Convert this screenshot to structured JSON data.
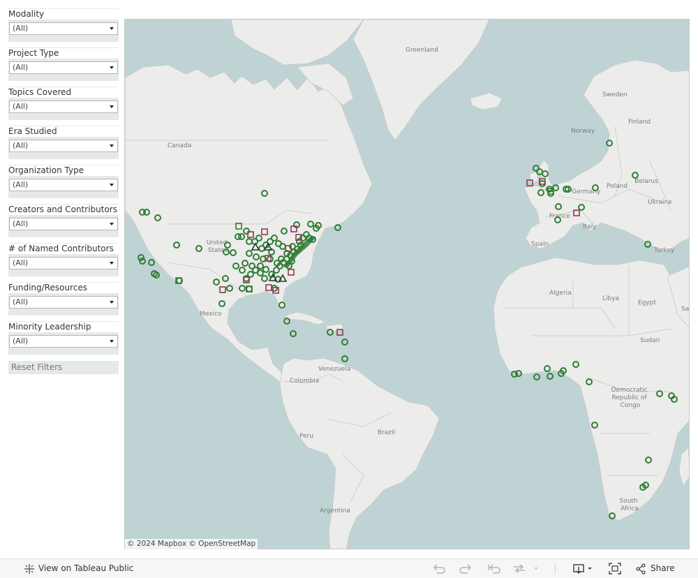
{
  "filters": [
    {
      "label": "Modality",
      "value": "(All)"
    },
    {
      "label": "Project Type",
      "value": "(All)"
    },
    {
      "label": "Topics Covered",
      "value": "(All)"
    },
    {
      "label": "Era Studied",
      "value": "(All)"
    },
    {
      "label": "Organization Type",
      "value": "(All)"
    },
    {
      "label": "Creators and Contributors",
      "value": "(All)"
    },
    {
      "label": "# of Named Contributors",
      "value": "(All)"
    },
    {
      "label": "Funding/Resources",
      "value": "(All)"
    },
    {
      "label": "Minority Leadership",
      "value": "(All)"
    }
  ],
  "reset_label": "Reset Filters",
  "map": {
    "labels": [
      "Greenland",
      "Canada",
      "Sweden",
      "Finland",
      "Norway",
      "Belarus",
      "Poland",
      "Ukraine",
      "Germany",
      "France",
      "Italy",
      "Spain",
      "Turkey",
      "Algeria",
      "Libya",
      "Egypt",
      "Sudan",
      "Mexico",
      "Venezuela",
      "Colombia",
      "Brazil",
      "Peru",
      "Argentina",
      "Democratic Republic of Congo",
      "South Africa",
      "United States",
      "Sau"
    ],
    "attribution": "© 2024 Mapbox © OpenStreetMap",
    "colors": {
      "water": "#bfd3d4",
      "land": "#ececeb",
      "marker_green": "#2e7d32",
      "marker_red": "#8c3b4f"
    }
  },
  "toolbar": {
    "view_label": "View on Tableau Public",
    "share_label": "Share",
    "icons": [
      "tableau-logo-icon",
      "undo-icon",
      "redo-icon",
      "revert-icon",
      "refresh-icon",
      "download-icon",
      "fullscreen-icon",
      "share-icon"
    ]
  }
}
